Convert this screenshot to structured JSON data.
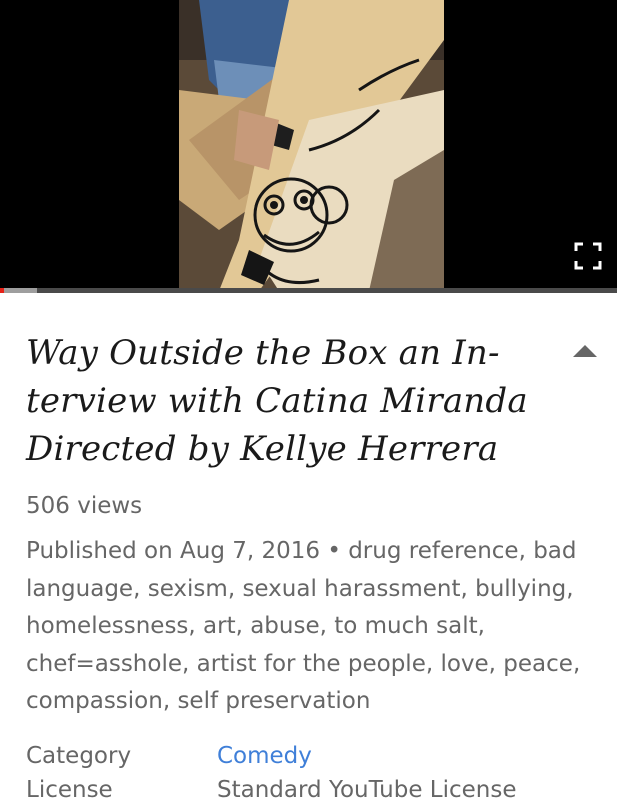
{
  "player": {
    "progress_fraction": 0.006,
    "buffered_fraction": 0.06,
    "fullscreen_icon": "fullscreen-icon"
  },
  "video": {
    "title": "Way Outside the Box an In-terview with Catina Miranda Directed by Kellye Herrera",
    "views": "506 views",
    "collapse_icon": "chevron-up-icon",
    "description": "Published on Aug 7, 2016 • drug reference, bad language, sexism, sexual harassment, bullying, homelessness, art, abuse, to much salt, chef=asshole, artist for the people, love, peace, compassion, self preservation"
  },
  "meta": {
    "category_label": "Category",
    "category_value": "Comedy",
    "license_label": "License",
    "license_value": "Standard YouTube License"
  },
  "colors": {
    "progress_played": "#e62117",
    "link": "#3f7fd8",
    "muted_text": "#666666"
  }
}
